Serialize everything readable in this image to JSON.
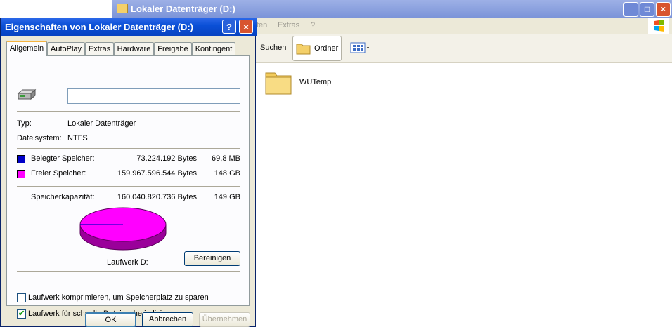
{
  "explorer": {
    "title": "Lokaler Datenträger (D:)",
    "menu": [
      "ten",
      "Extras",
      "?"
    ],
    "toolbar": {
      "search_label": "Suchen",
      "folders_label": "Ordner"
    },
    "controls": {
      "minimize": "_",
      "maximize": "□",
      "close": "×"
    },
    "items": [
      {
        "name": "WUTemp"
      }
    ]
  },
  "dialog": {
    "title": "Eigenschaften von Lokaler Datenträger (D:)",
    "help": "?",
    "close": "×",
    "tabs": [
      "Allgemein",
      "AutoPlay",
      "Extras",
      "Hardware",
      "Freigabe",
      "Kontingent"
    ],
    "active_tab": "Allgemein",
    "drive_name_value": "",
    "type_label": "Typ:",
    "type_value": "Lokaler Datenträger",
    "fs_label": "Dateisystem:",
    "fs_value": "NTFS",
    "used": {
      "label": "Belegter Speicher:",
      "bytes": "73.224.192 Bytes",
      "size": "69,8 MB",
      "color": "#0000c8"
    },
    "free": {
      "label": "Freier Speicher:",
      "bytes": "159.967.596.544 Bytes",
      "size": "148 GB",
      "color": "#ff00ff"
    },
    "capacity": {
      "label": "Speicherkapazität:",
      "bytes": "160.040.820.736 Bytes",
      "size": "149 GB"
    },
    "used_fraction": 0.000458,
    "drive_label": "Laufwerk D:",
    "cleanup_button": "Bereinigen",
    "compress_label": "Laufwerk komprimieren, um Speicherplatz zu sparen",
    "compress_checked": false,
    "index_label": "Laufwerk für schnelle Dateisuche indizieren",
    "index_checked": true,
    "ok": "OK",
    "cancel": "Abbrechen",
    "apply": "Übernehmen"
  }
}
